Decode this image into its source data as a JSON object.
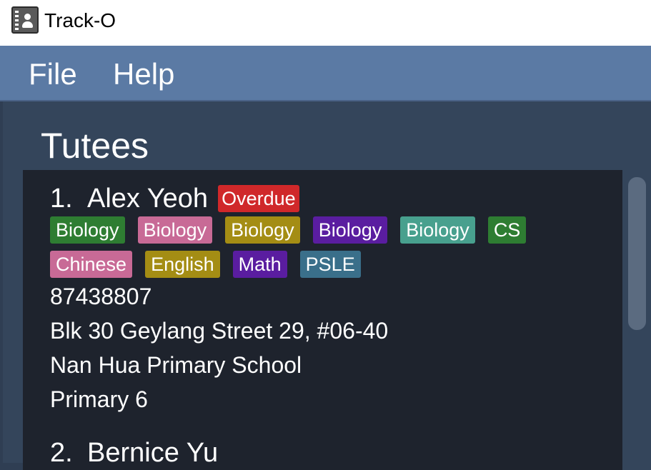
{
  "window": {
    "title": "Track-O"
  },
  "menu": {
    "file_label": "File",
    "help_label": "Help"
  },
  "section": {
    "title": "Tutees"
  },
  "tutees": [
    {
      "index": "1.",
      "name": "Alex Yeoh",
      "status": "Overdue",
      "tags": [
        {
          "label": "Biology",
          "color": "#2e7d32"
        },
        {
          "label": "Biology",
          "color": "#c86a96"
        },
        {
          "label": "Biology",
          "color": "#a48d14"
        },
        {
          "label": "Biology",
          "color": "#5a1da0"
        },
        {
          "label": "Biology",
          "color": "#48a08e"
        },
        {
          "label": "CS",
          "color": "#2e7d32"
        },
        {
          "label": "Chinese",
          "color": "#c86a96"
        },
        {
          "label": "English",
          "color": "#a48d14"
        },
        {
          "label": "Math",
          "color": "#5a1da0"
        },
        {
          "label": "PSLE",
          "color": "#3a6f8a"
        }
      ],
      "phone": "87438807",
      "address": "Blk 30 Geylang Street 29, #06-40",
      "school": "Nan Hua Primary School",
      "level": "Primary 6"
    },
    {
      "index": "2.",
      "name": "Bernice Yu"
    }
  ],
  "colors": {
    "titlebar_bg": "#ffffff",
    "menubar_bg": "#5b7aa4",
    "main_bg": "#34455b",
    "list_bg": "#1e232d",
    "overdue_badge": "#d0282a"
  }
}
